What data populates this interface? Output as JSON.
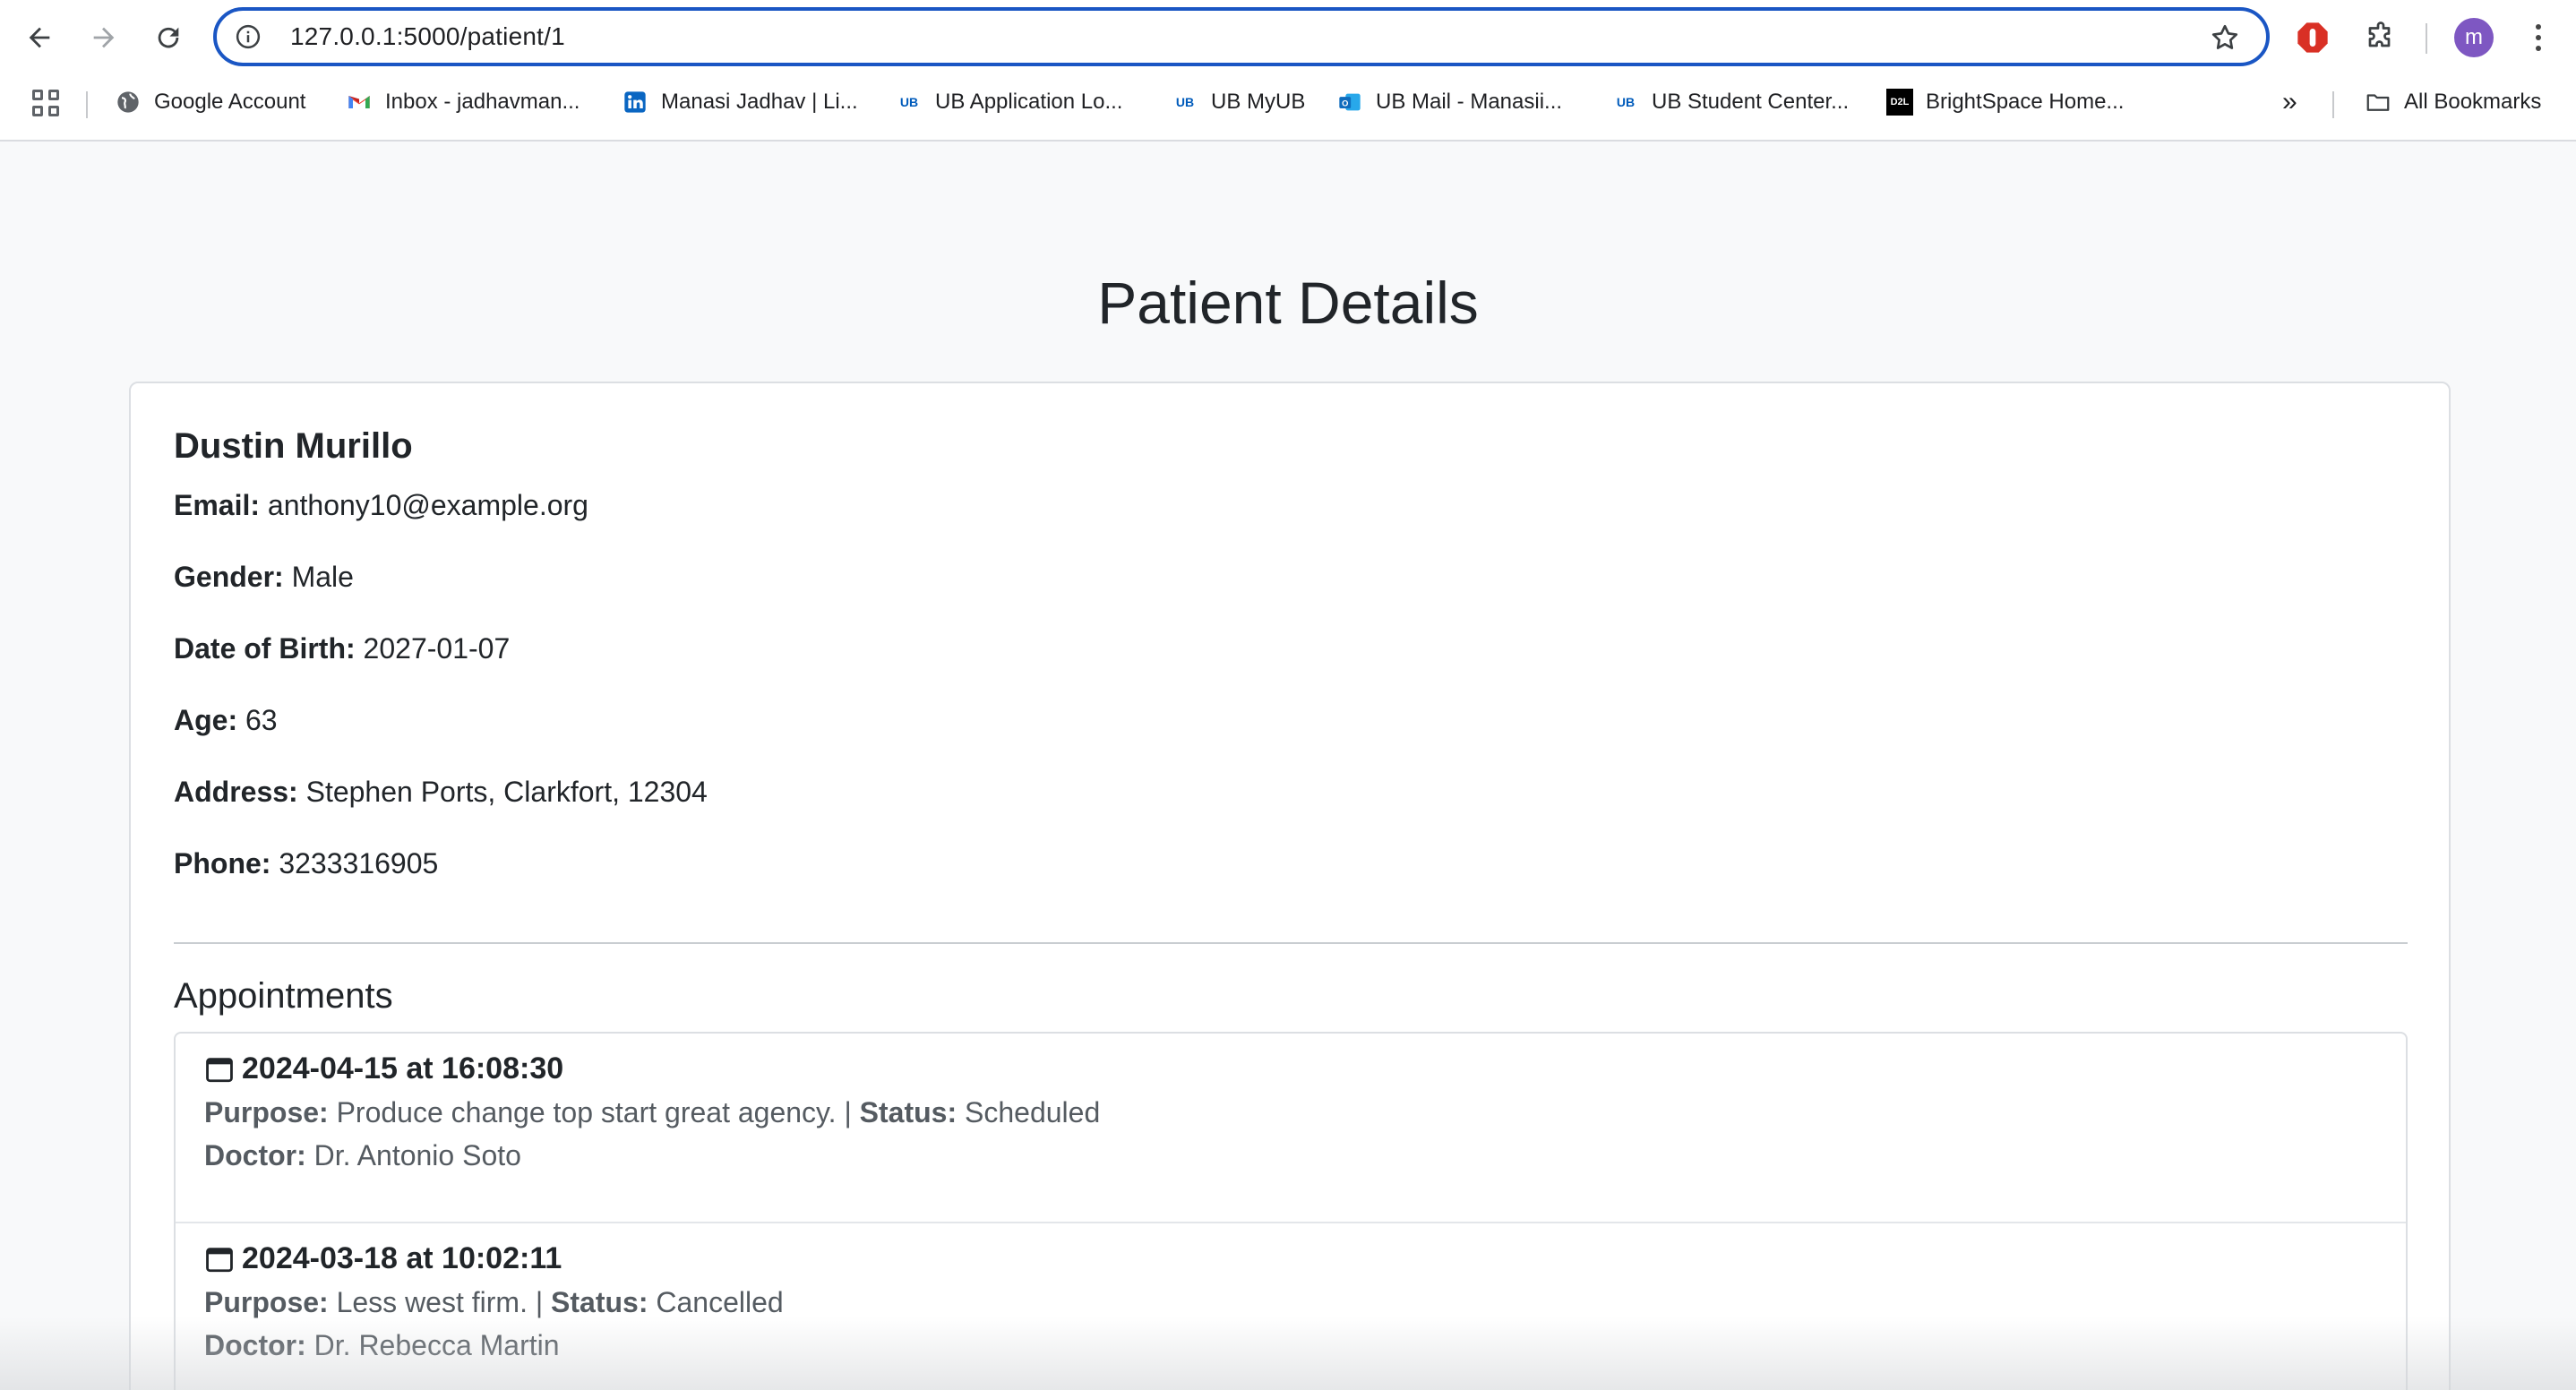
{
  "browser": {
    "url": "127.0.0.1:5000/patient/1",
    "avatar_letter": "m",
    "bookmarks": [
      {
        "label": "Google Account",
        "icon": "globe-icon"
      },
      {
        "label": "Inbox - jadhavman...",
        "icon": "gmail-icon"
      },
      {
        "label": "Manasi Jadhav | Li...",
        "icon": "linkedin-icon"
      },
      {
        "label": "UB Application Lo...",
        "icon": "ub-icon"
      },
      {
        "label": "UB MyUB",
        "icon": "ub-icon"
      },
      {
        "label": "UB Mail - Manasii...",
        "icon": "outlook-icon"
      },
      {
        "label": "UB Student Center...",
        "icon": "ub-icon"
      },
      {
        "label": "BrightSpace Home...",
        "icon": "d2l-icon"
      }
    ],
    "all_bookmarks_label": "All Bookmarks",
    "more_label": "»"
  },
  "page": {
    "title": "Patient Details"
  },
  "patient": {
    "name": "Dustin Murillo",
    "email_label": "Email:",
    "email": "anthony10@example.org",
    "gender_label": "Gender:",
    "gender": "Male",
    "dob_label": "Date of Birth:",
    "dob": "2027-01-07",
    "age_label": "Age:",
    "age": "63",
    "address_label": "Address:",
    "address": "Stephen Ports, Clarkfort, 12304",
    "phone_label": "Phone:",
    "phone": "3233316905"
  },
  "appointments": {
    "heading": "Appointments",
    "purpose_label": "Purpose:",
    "status_label": "Status:",
    "doctor_label": "Doctor:",
    "separator": "|",
    "items": [
      {
        "datetime": "2024-04-15 at 16:08:30",
        "purpose": "Produce change top start great agency.",
        "status": "Scheduled",
        "doctor": "Dr. Antonio Soto"
      },
      {
        "datetime": "2024-03-18 at 10:02:11",
        "purpose": "Less west firm.",
        "status": "Cancelled",
        "doctor": "Dr. Rebecca Martin"
      }
    ]
  },
  "colors": {
    "omnibox_border": "#1a56c4",
    "page_background": "#f8f9fa",
    "avatar": "#7e57c2",
    "muted_text": "#555b61"
  }
}
